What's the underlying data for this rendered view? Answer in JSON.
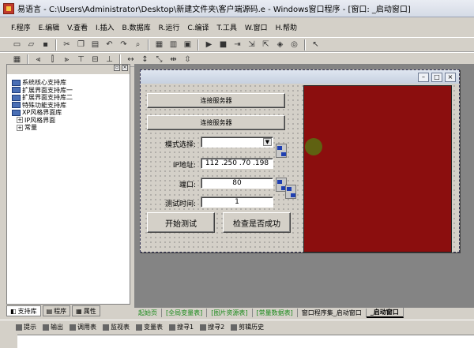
{
  "title": "易语言 - C:\\Users\\Administrator\\Desktop\\新建文件夹\\客户端源码.e - Windows窗口程序 - [窗口: _启动窗口]",
  "menu": [
    "F.程序",
    "E.编辑",
    "V.查看",
    "I.插入",
    "B.数据库",
    "R.运行",
    "C.编译",
    "T.工具",
    "W.窗口",
    "H.帮助"
  ],
  "toolbar1_icons": [
    "new-icon",
    "open-icon",
    "save-icon",
    "cut-icon",
    "copy-icon",
    "paste-icon",
    "undo-icon",
    "redo-icon",
    "find-icon",
    "run-icon",
    "stop-icon",
    "step-icon",
    "debug-icon"
  ],
  "tree": {
    "items": [
      {
        "label": "系统核心支持库",
        "sub": false
      },
      {
        "label": "扩展界面支持库一",
        "sub": false
      },
      {
        "label": "扩展界面支持库二",
        "sub": false
      },
      {
        "label": "特殊功能支持库",
        "sub": false
      },
      {
        "label": "XP风格界面库",
        "sub": false
      },
      {
        "label": "IP风格界面",
        "sub": true
      },
      {
        "label": "常量",
        "sub": true
      }
    ]
  },
  "left_tabs": [
    "支持库",
    "程序",
    "属性"
  ],
  "form": {
    "btn_connect1": "连接服务器",
    "btn_connect2": "连接服务器",
    "lbl_mode": "模式选择:",
    "lbl_ip": "IP地址:",
    "ip_value": "112 .250 .70 .198",
    "lbl_port": "端口:",
    "port_value": "80",
    "lbl_time": "测试时间:",
    "time_value": "1",
    "btn_start": "开始测试",
    "btn_check": "检查是否成功"
  },
  "bottom_tabs": [
    "起始页",
    "[全局变量表]",
    "[图片资源表]",
    "[常量数据表]",
    "窗口程序集_启动窗口",
    "_启动窗口"
  ],
  "output_tabs": [
    "提示",
    "输出",
    "调用表",
    "监视表",
    "变量表",
    "搜寻1",
    "搜寻2",
    "剪辑历史"
  ],
  "colors": {
    "panel_red": "#8b0e0e",
    "accent_green": "#1a8a1a"
  }
}
